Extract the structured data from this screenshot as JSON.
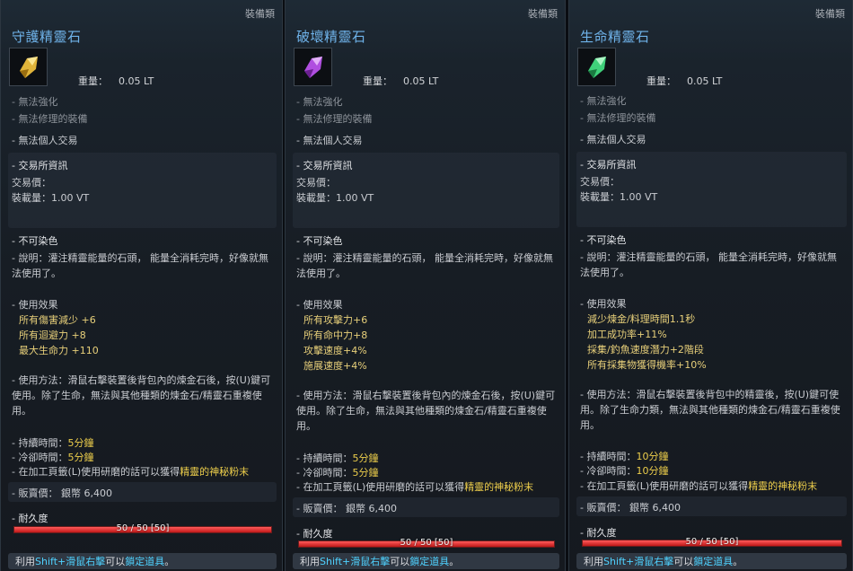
{
  "common": {
    "type": "裝備類",
    "weight_label": "重量：",
    "weight_value": "0.05 LT",
    "no_enhance": "- 無法強化",
    "no_repair": "- 無法修理的裝備",
    "no_trade": "- 無法個人交易",
    "market_head": "- 交易所資訊",
    "market_price": "交易價：",
    "market_load": "裝載量：1.00 VT",
    "no_dye": "- 不可染色",
    "desc": "- 說明：灌注精靈能量的石頭， 能量全消耗完時，好像就無法使用了。",
    "effect_head": "- 使用效果",
    "duration_label": "- 持續時間：",
    "cooldown_label": "- 冷卻時間：",
    "craft_prefix": "- 在加工頁籤(L)使用研磨的話可以獲得",
    "craft_item": "精靈的神秘粉末",
    "sell_label": "- 販賣價：",
    "sell_value": "銀幣 6,400",
    "dur_label": "- 耐久度",
    "dur_text": "50 / 50 [50]",
    "dur_fraction": 1.0,
    "footer_a": "利用",
    "footer_b": "Shift+滑鼠右擊",
    "footer_c": "可以",
    "footer_d": "鎖定道具",
    "footer_e": "。"
  },
  "panels": [
    {
      "name": "守護精靈石",
      "effects": [
        "所有傷害減少 +6",
        "所有迴避力 +8",
        "最大生命力 +110"
      ],
      "usage": "- 使用方法：滑鼠右擊裝置後背包內的煉金石後，按(U)鍵可使用。除了生命，無法與其他種類的煉金石/精靈石重複使用。",
      "duration": "5分鐘",
      "cooldown": "5分鐘",
      "gem_color": "#e0b43a"
    },
    {
      "name": "破壞精靈石",
      "effects": [
        "所有攻擊力+6",
        "所有命中力+8",
        "攻擊速度+4%",
        "施展速度+4%"
      ],
      "usage": "- 使用方法：滑鼠右擊裝置後背包內的煉金石後，按(U)鍵可使用。除了生命，無法與其他種類的煉金石/精靈石重複使用。",
      "duration": "5分鐘",
      "cooldown": "5分鐘",
      "gem_color": "#b04fe0"
    },
    {
      "name": "生命精靈石",
      "effects": [
        "減少煉金/料理時間1.1秒",
        "加工成功率+11%",
        "採集/釣魚速度潛力+2階段",
        "所有採集物獲得機率+10%"
      ],
      "usage": "- 使用方法：滑鼠右擊裝置後背包中的精靈後，按(U)鍵可使用。除了生命力類，無法與其他種類的煉金石/精靈石重複使用。",
      "duration": "10分鐘",
      "cooldown": "10分鐘",
      "gem_color": "#3fd07a"
    }
  ]
}
